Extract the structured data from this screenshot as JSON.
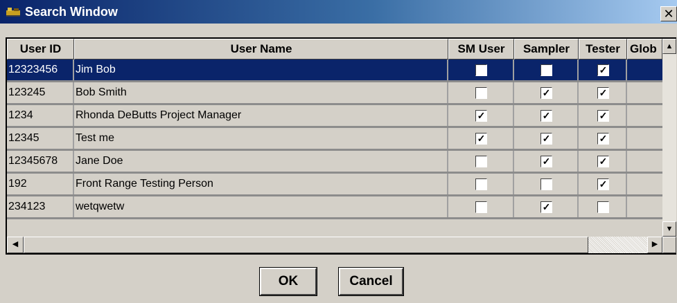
{
  "window": {
    "title": "Search Window",
    "close_glyph": "✕"
  },
  "grid": {
    "headers": [
      "User ID",
      "User Name",
      "SM User",
      "Sampler",
      "Tester",
      "Glob"
    ],
    "rows": [
      {
        "id": "12323456",
        "name": "Jim Bob",
        "sm_user": false,
        "sampler": false,
        "tester": true,
        "selected": true
      },
      {
        "id": "123245",
        "name": "Bob Smith",
        "sm_user": false,
        "sampler": true,
        "tester": true,
        "selected": false
      },
      {
        "id": "1234",
        "name": "Rhonda DeButts Project Manager",
        "sm_user": true,
        "sampler": true,
        "tester": true,
        "selected": false
      },
      {
        "id": "12345",
        "name": "Test me",
        "sm_user": true,
        "sampler": true,
        "tester": true,
        "selected": false
      },
      {
        "id": "12345678",
        "name": "Jane Doe",
        "sm_user": false,
        "sampler": true,
        "tester": true,
        "selected": false
      },
      {
        "id": "192",
        "name": "Front Range Testing Person",
        "sm_user": false,
        "sampler": false,
        "tester": true,
        "selected": false
      },
      {
        "id": "234123",
        "name": "wetqwetw",
        "sm_user": false,
        "sampler": true,
        "tester": false,
        "selected": false
      }
    ]
  },
  "buttons": {
    "ok": "OK",
    "cancel": "Cancel"
  },
  "icons": {
    "app": "app-icon",
    "scroll_up": "scroll-up-icon",
    "scroll_down": "scroll-down-icon",
    "scroll_left": "scroll-left-icon",
    "scroll_right": "scroll-right-icon"
  },
  "colors": {
    "title_start": "#0a246a",
    "title_end": "#a6caf0",
    "selection": "#0a246a",
    "face": "#d4d0c8"
  }
}
